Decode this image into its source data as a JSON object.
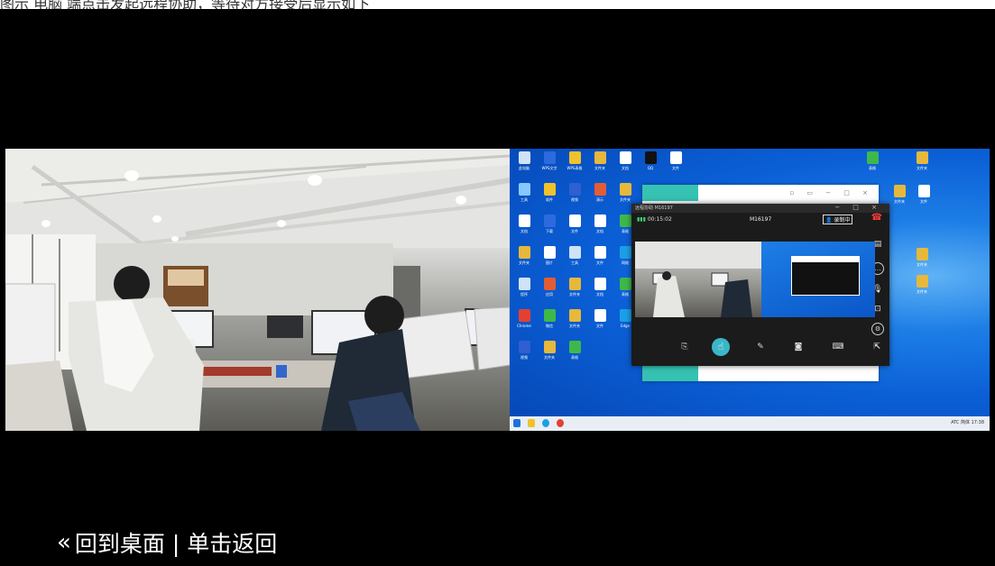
{
  "top_caption": "图示 电脑 端点击发起远程协助，等待对方接受后显示如下",
  "hint": {
    "back_icon": "double-chevron-left-icon",
    "text": "回到桌面 | 单击返回"
  },
  "desktop": {
    "icons": [
      {
        "label": "此电脑",
        "color": "#cfe3f7"
      },
      {
        "label": "WPS文字",
        "color": "#2d6ae0"
      },
      {
        "label": "WPS表格",
        "color": "#f0c22b"
      },
      {
        "label": "文件夹",
        "color": "#e6b83b"
      },
      {
        "label": "文档",
        "color": "#ffffff"
      },
      {
        "label": "QQ",
        "color": "#111111"
      },
      {
        "label": "文件",
        "color": "#ffffff"
      },
      {
        "label": "工具",
        "color": "#88c8ff"
      },
      {
        "label": "软件",
        "color": "#f0c22b"
      },
      {
        "label": "视频",
        "color": "#2f5fd0"
      },
      {
        "label": "演示",
        "color": "#e25d35"
      },
      {
        "label": "文件夹",
        "color": "#e6b83b"
      },
      {
        "label": "文档",
        "color": "#ffffff"
      },
      {
        "label": "下载",
        "color": "#2d6ae0"
      },
      {
        "label": "文件",
        "color": "#ffffff"
      },
      {
        "label": "文档",
        "color": "#ffffff"
      },
      {
        "label": "表格",
        "color": "#3fb84a"
      },
      {
        "label": "文件夹",
        "color": "#e6b83b"
      },
      {
        "label": "图片",
        "color": "#ffffff"
      },
      {
        "label": "工具",
        "color": "#cfe3f7"
      },
      {
        "label": "文件",
        "color": "#ffffff"
      },
      {
        "label": "网络",
        "color": "#1a9fe8"
      },
      {
        "label": "程序",
        "color": "#cfe3f7"
      },
      {
        "label": "应用",
        "color": "#e25d35"
      },
      {
        "label": "文件夹",
        "color": "#e6b83b"
      },
      {
        "label": "文档",
        "color": "#ffffff"
      },
      {
        "label": "表格",
        "color": "#3fb84a"
      },
      {
        "label": "Chrome",
        "color": "#e34133"
      },
      {
        "label": "微信",
        "color": "#3fb84a"
      },
      {
        "label": "文件夹",
        "color": "#e6b83b"
      },
      {
        "label": "文件",
        "color": "#ffffff"
      },
      {
        "label": "Edge",
        "color": "#1a9fe8"
      },
      {
        "label": "视频",
        "color": "#2f5fd0"
      },
      {
        "label": "文件夹",
        "color": "#e6b83b"
      },
      {
        "label": "表格",
        "color": "#3fb84a"
      }
    ],
    "right_icons": [
      {
        "label": "表格",
        "color": "#3fb84a"
      },
      {
        "label": "文件夹",
        "color": "#e6b83b"
      },
      {
        "label": "文件夹",
        "color": "#e6b83b"
      },
      {
        "label": "文件",
        "color": "#ffffff"
      },
      {
        "label": "文件夹",
        "color": "#e6b83b"
      },
      {
        "label": "文件夹",
        "color": "#e6b83b"
      }
    ],
    "tray_text": "ATC 简体  17:38",
    "call_window": {
      "title": "远程协助 M16197",
      "timer": "00:15:02",
      "caller_id": "M16197",
      "recording": "录制中",
      "hangup_icon": "hang-up-icon",
      "side_icons": [
        "chat-icon",
        "message-icon",
        "microphone-icon",
        "screenshot-icon",
        "settings-icon",
        "cursor-icon"
      ],
      "tools": [
        "file-transfer-icon",
        "remote-control-icon",
        "pen-icon",
        "camera-icon",
        "keyboard-icon",
        "pointer-icon"
      ]
    }
  }
}
